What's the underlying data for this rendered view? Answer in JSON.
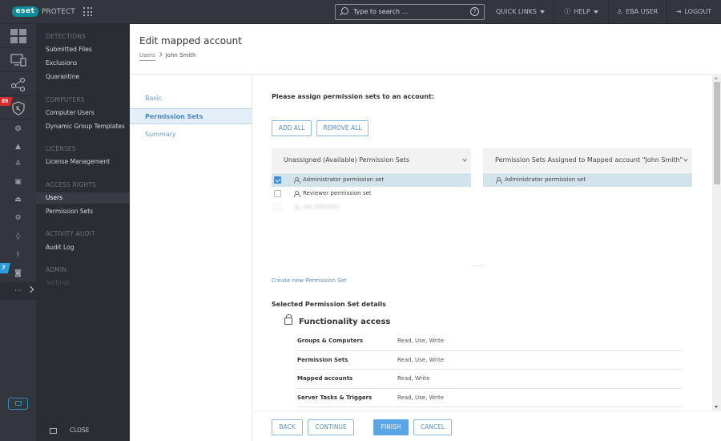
{
  "topbar": {
    "logo": "eset",
    "product": "PROTECT",
    "search_placeholder": "Type to search ...",
    "quick_links": "QUICK LINKS",
    "help": "HELP",
    "user": "EBA USER",
    "logout": "LOGOUT"
  },
  "rail": {
    "detections_badge": "89",
    "admin_badge": "7",
    "more": "···"
  },
  "subnav": {
    "sections": [
      {
        "title": "DETECTIONS",
        "items": [
          "Submitted Files",
          "Exclusions",
          "Quarantine"
        ]
      },
      {
        "title": "COMPUTERS",
        "items": [
          "Computer Users",
          "Dynamic Group Templates"
        ]
      },
      {
        "title": "LICENSES",
        "items": [
          "License Management"
        ]
      },
      {
        "title": "ACCESS RIGHTS",
        "items": [
          "Users",
          "Permission Sets"
        ]
      },
      {
        "title": "ACTIVITY AUDIT",
        "items": [
          "Audit Log"
        ]
      },
      {
        "title": "ADMIN",
        "items": [
          "Settings"
        ]
      }
    ],
    "active_item": "Users",
    "close_label": "CLOSE"
  },
  "page": {
    "title": "Edit mapped account",
    "breadcrumb": [
      "Users",
      "John Smith"
    ]
  },
  "wizard": {
    "steps": [
      "Basic",
      "Permission Sets",
      "Summary"
    ],
    "active_step": "Permission Sets"
  },
  "content": {
    "lead": "Please assign permission sets to an account:",
    "add_all": "ADD ALL",
    "remove_all": "REMOVE ALL",
    "unassigned": {
      "header": "Unassigned (Available) Permission Sets",
      "rows": [
        {
          "label": "Administrator permission set",
          "checked": true
        },
        {
          "label": "Reviewer permission set",
          "checked": false
        },
        {
          "label": "Set Selection",
          "checked": false,
          "disabled": true
        }
      ]
    },
    "assigned": {
      "header": "Permission Sets Assigned to Mapped account \"John Smith\"",
      "rows": [
        {
          "label": "Administrator permission set"
        }
      ]
    },
    "create_link": "Create new Permission Set",
    "details_title": "Selected Permission Set details",
    "functionality_title": "Functionality access",
    "permissions": [
      {
        "name": "Groups & Computers",
        "access": "Read, Use, Write"
      },
      {
        "name": "Permission Sets",
        "access": "Read, Use, Write"
      },
      {
        "name": "Mapped accounts",
        "access": "Read, Write"
      },
      {
        "name": "Server Tasks & Triggers",
        "access": "Read, Use, Write"
      }
    ]
  },
  "footer": {
    "back": "BACK",
    "continue": "CONTINUE",
    "finish": "FINISH",
    "cancel": "CANCEL"
  },
  "colors": {
    "brand": "#0a8d9b",
    "accent": "#5aa5e6",
    "badge_red": "#d32f2f",
    "badge_blue": "#2d9be0"
  }
}
